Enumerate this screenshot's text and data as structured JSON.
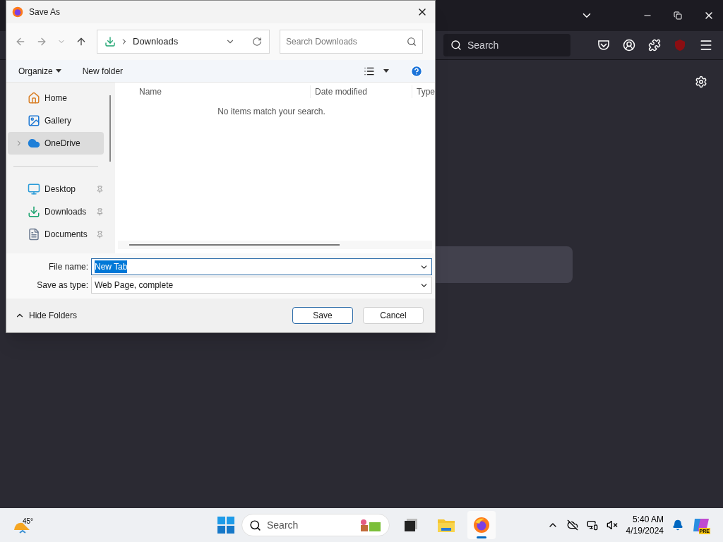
{
  "browser": {
    "search_placeholder": "Search"
  },
  "dialog": {
    "title": "Save As",
    "breadcrumb": "Downloads",
    "search_placeholder": "Search Downloads",
    "toolbar": [
      "Organize",
      "New folder"
    ],
    "nav_top": [
      {
        "label": "Home",
        "kind": "home",
        "selected": false,
        "expandable": false
      },
      {
        "label": "Gallery",
        "kind": "gallery",
        "selected": false,
        "expandable": false
      },
      {
        "label": "OneDrive",
        "kind": "cloud",
        "selected": true,
        "expandable": true
      }
    ],
    "nav_pinned": [
      {
        "label": "Desktop",
        "kind": "desktop",
        "selected": false
      },
      {
        "label": "Downloads",
        "kind": "download",
        "selected": false
      },
      {
        "label": "Documents",
        "kind": "document",
        "selected": false
      }
    ],
    "columns": [
      "Name",
      "Date modified",
      "Type"
    ],
    "empty_message": "No items match your search.",
    "file_name_label": "File name:",
    "file_name": "New Tab",
    "file_name_selected": true,
    "type_label": "Save as type:",
    "type_value": "Web Page, complete",
    "hide_folders": "Hide Folders",
    "buttons": [
      {
        "label": "Save",
        "default": true
      },
      {
        "label": "Cancel",
        "default": false
      }
    ]
  },
  "taskbar": {
    "weather": "45°",
    "search_placeholder": "Search",
    "apps": [
      {
        "kind": "taskview",
        "selected": false
      },
      {
        "kind": "folder",
        "selected": false
      },
      {
        "kind": "firefox",
        "selected": true
      }
    ],
    "time": "5:40 AM",
    "date": "4/19/2024",
    "copilot_badge": "PRE"
  }
}
